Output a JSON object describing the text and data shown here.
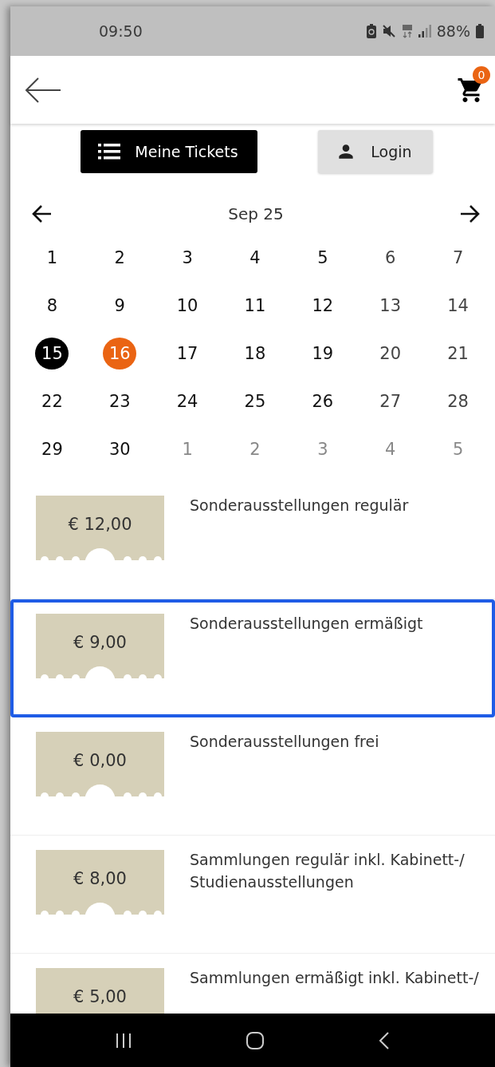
{
  "status_bar": {
    "time": "09:50",
    "battery": "88%"
  },
  "header": {
    "cart_count": "0"
  },
  "buttons": [
    {
      "label": "Meine Tickets",
      "kind": "primary"
    },
    {
      "label": "Login",
      "kind": "secondary"
    }
  ],
  "calendar": {
    "month": "Sep 25",
    "weeks": [
      [
        {
          "day": "1",
          "kind": "weekday",
          "selected": false,
          "today": false
        },
        {
          "day": "2",
          "kind": "weekday",
          "selected": false,
          "today": false
        },
        {
          "day": "3",
          "kind": "weekday",
          "selected": false,
          "today": false
        },
        {
          "day": "4",
          "kind": "weekday",
          "selected": false,
          "today": false
        },
        {
          "day": "5",
          "kind": "weekday",
          "selected": false,
          "today": false
        },
        {
          "day": "6",
          "kind": "weekend",
          "selected": false,
          "today": false
        },
        {
          "day": "7",
          "kind": "weekend",
          "selected": false,
          "today": false
        }
      ],
      [
        {
          "day": "8",
          "kind": "weekday",
          "selected": false,
          "today": false
        },
        {
          "day": "9",
          "kind": "weekday",
          "selected": false,
          "today": false
        },
        {
          "day": "10",
          "kind": "weekday",
          "selected": false,
          "today": false
        },
        {
          "day": "11",
          "kind": "weekday",
          "selected": false,
          "today": false
        },
        {
          "day": "12",
          "kind": "weekday",
          "selected": false,
          "today": false
        },
        {
          "day": "13",
          "kind": "weekend",
          "selected": false,
          "today": false
        },
        {
          "day": "14",
          "kind": "weekend",
          "selected": false,
          "today": false
        }
      ],
      [
        {
          "day": "15",
          "kind": "weekday",
          "selected": true,
          "today": false
        },
        {
          "day": "16",
          "kind": "weekday",
          "selected": false,
          "today": true
        },
        {
          "day": "17",
          "kind": "weekday",
          "selected": false,
          "today": false
        },
        {
          "day": "18",
          "kind": "weekday",
          "selected": false,
          "today": false
        },
        {
          "day": "19",
          "kind": "weekday",
          "selected": false,
          "today": false
        },
        {
          "day": "20",
          "kind": "weekend",
          "selected": false,
          "today": false
        },
        {
          "day": "21",
          "kind": "weekend",
          "selected": false,
          "today": false
        }
      ],
      [
        {
          "day": "22",
          "kind": "weekday",
          "selected": false,
          "today": false
        },
        {
          "day": "23",
          "kind": "weekday",
          "selected": false,
          "today": false
        },
        {
          "day": "24",
          "kind": "weekday",
          "selected": false,
          "today": false
        },
        {
          "day": "25",
          "kind": "weekday",
          "selected": false,
          "today": false
        },
        {
          "day": "26",
          "kind": "weekday",
          "selected": false,
          "today": false
        },
        {
          "day": "27",
          "kind": "weekend",
          "selected": false,
          "today": false
        },
        {
          "day": "28",
          "kind": "weekend",
          "selected": false,
          "today": false
        }
      ],
      [
        {
          "day": "29",
          "kind": "weekday",
          "selected": false,
          "today": false
        },
        {
          "day": "30",
          "kind": "weekday",
          "selected": false,
          "today": false
        },
        {
          "day": "1",
          "kind": "other_month",
          "selected": false,
          "today": false
        },
        {
          "day": "2",
          "kind": "other_month",
          "selected": false,
          "today": false
        },
        {
          "day": "3",
          "kind": "other_month",
          "selected": false,
          "today": false
        },
        {
          "day": "4",
          "kind": "other_month",
          "selected": false,
          "today": false
        },
        {
          "day": "5",
          "kind": "other_month",
          "selected": false,
          "today": false
        }
      ]
    ]
  },
  "tickets": [
    {
      "price": "€ 12,00",
      "title": "Sonderausstellungen regulär",
      "selected": false
    },
    {
      "price": "€ 9,00",
      "title": "Sonderausstellungen ermäßigt",
      "selected": true
    },
    {
      "price": "€ 0,00",
      "title": "Sonderausstellungen frei",
      "selected": false
    },
    {
      "price": "€ 8,00",
      "title": "Sammlungen regulär inkl. Kabinett-/ Studienausstellungen",
      "selected": false
    },
    {
      "price": "€ 5,00",
      "title": "Sammlungen ermäßigt inkl. Kabinett-/",
      "selected": false
    }
  ]
}
